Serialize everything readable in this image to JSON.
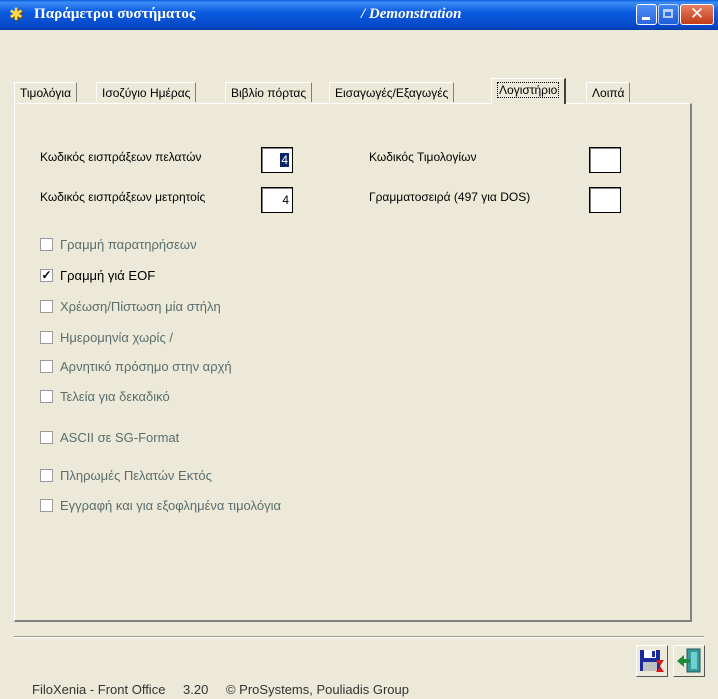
{
  "window": {
    "title": "Παράμετροι συστήματος",
    "database": "/ Demonstration"
  },
  "tabs": [
    {
      "label": "Τιμολόγια",
      "active": false
    },
    {
      "label": "Ισοζύγιο Ημέρας",
      "active": false
    },
    {
      "label": "Βιβλίο πόρτας",
      "active": false
    },
    {
      "label": "Εισαγωγές/Εξαγωγές",
      "active": false
    },
    {
      "label": "Λογιστήριο",
      "active": true
    },
    {
      "label": "Λοιπά",
      "active": false
    }
  ],
  "fields": {
    "customer_receipts_code": {
      "label": "Κωδικός εισπράξεων πελατών",
      "value": "4"
    },
    "cash_receipts_code": {
      "label": "Κωδικός εισπράξεων μετρητοίς",
      "value": "4"
    },
    "invoices_code": {
      "label": "Κωδικός Τιμολογίων",
      "value": ""
    },
    "charset": {
      "label": "Γραμματοσειρά (497 για DOS)",
      "value": ""
    }
  },
  "checkboxes": [
    {
      "label": "Γραμμή παρατηρήσεων",
      "checked": false
    },
    {
      "label": "Γραμμή γιά EOF",
      "checked": true
    },
    {
      "label": "Χρέωση/Πίστωση μία στήλη",
      "checked": false
    },
    {
      "label": "Ημερομηνία χωρίς /",
      "checked": false
    },
    {
      "label": "Αρνητικό πρόσημο στην αρχή",
      "checked": false
    },
    {
      "label": "Τελεία για δεκαδικό",
      "checked": false
    },
    {
      "label": "ASCII σε SG-Format",
      "checked": false
    },
    {
      "label": "Πληρωμές Πελατών Εκτός",
      "checked": false
    },
    {
      "label": "Εγγραφή και για εξοφλημένα τιμολόγια",
      "checked": false
    }
  ],
  "status": {
    "product": "FiloXenia - Front Office",
    "version": "3.20",
    "copyright": "© ProSystems, Pouliadis Group"
  },
  "icons": {
    "save": "save-icon",
    "exit": "exit-icon"
  }
}
